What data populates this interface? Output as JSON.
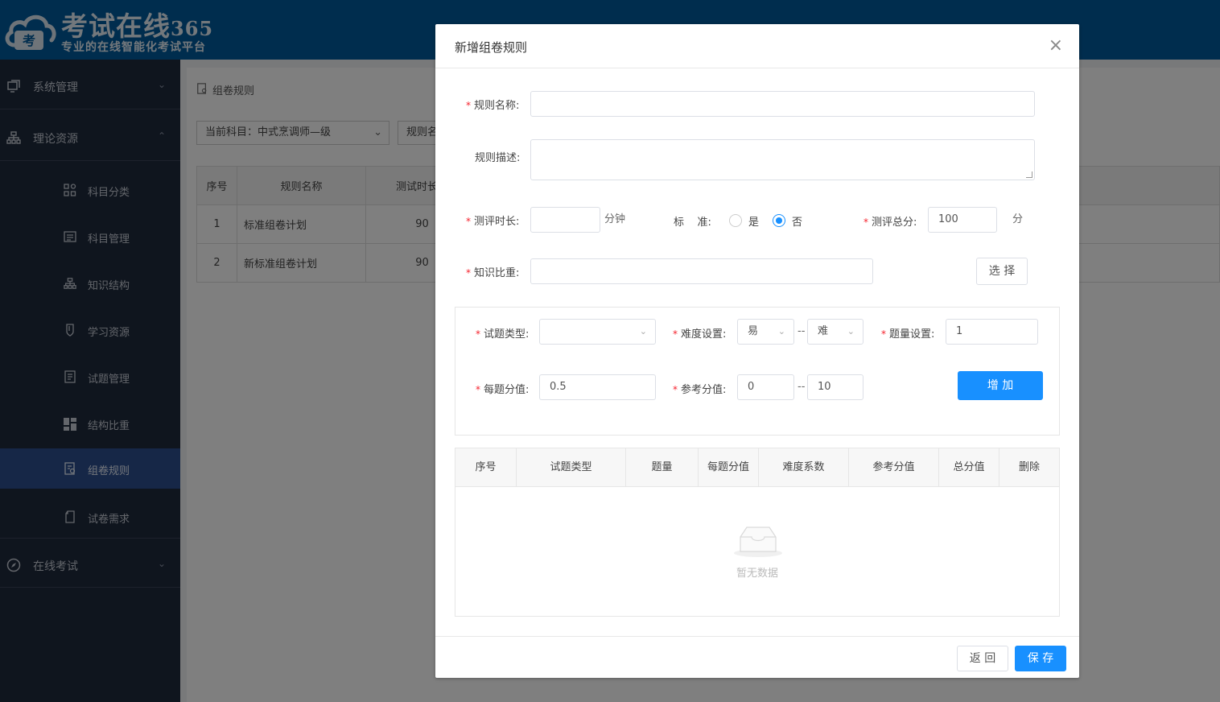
{
  "header": {
    "logo_badge": "考",
    "brand_title": "考试在线",
    "brand_num": "365",
    "brand_subtitle": "专业的在线智能化考试平台",
    "colors": {
      "header_bg": "#005a9c",
      "sidebar_bg": "#1f2a3d",
      "active_item": "#2c4f8f",
      "primary": "#1890ff",
      "required": "#f5222d"
    }
  },
  "sidebar": {
    "groups": [
      {
        "label": "系统管理",
        "icon": "monitor-icon",
        "arrow": "⌄"
      },
      {
        "label": "理论资源",
        "icon": "sitemap-icon",
        "arrow": "⌃"
      },
      {
        "label": "在线考试",
        "icon": "compass-icon",
        "arrow": "⌄"
      }
    ],
    "items": [
      {
        "label": "科目分类",
        "icon": "grid-icon"
      },
      {
        "label": "科目管理",
        "icon": "list-icon"
      },
      {
        "label": "知识结构",
        "icon": "sitemap-icon"
      },
      {
        "label": "学习资源",
        "icon": "bookmark-icon"
      },
      {
        "label": "试题管理",
        "icon": "document-icon"
      },
      {
        "label": "结构比重",
        "icon": "dashboard-icon"
      },
      {
        "label": "组卷规则",
        "icon": "rule-icon",
        "active": true
      },
      {
        "label": "试卷需求",
        "icon": "file-icon"
      }
    ]
  },
  "main": {
    "breadcrumb": "组卷规则",
    "subject_select": "当前科目：中式烹调师—级",
    "rule_filter_placeholder": "规则名",
    "table": {
      "headers": [
        "序号",
        "规则名称",
        "测试时长（"
      ],
      "rows": [
        [
          "1",
          "标准组卷计划",
          "90"
        ],
        [
          "2",
          "新标准组卷计划",
          "90"
        ]
      ]
    }
  },
  "dialog": {
    "title": "新增组卷规则",
    "close": "×",
    "rule_name_label": "规则名称:",
    "rule_name_value": "",
    "rule_desc_label": "规则描述:",
    "duration_label": "测评时长:",
    "duration_value": "",
    "duration_unit": "分钟",
    "standard_label": "标    准:",
    "standard_yes": "是",
    "standard_no": "否",
    "standard_selected": "否",
    "total_score_label": "测评总分:",
    "total_score_value": "100",
    "total_score_unit": "分",
    "knowledge_label": "知识比重:",
    "knowledge_value": "",
    "select_button": "选 择",
    "question_type_label": "试题类型:",
    "question_type_value": "",
    "difficulty_label": "难度设置:",
    "difficulty_from": "易",
    "difficulty_to": "难",
    "range_sep": "--",
    "quantity_label": "题量设置:",
    "quantity_value": "1",
    "per_score_label": "每题分值:",
    "per_score_value": "0.5",
    "ref_score_label": "参考分值:",
    "ref_score_from": "0",
    "ref_score_to": "10",
    "add_button": "增 加",
    "table_headers": [
      "序号",
      "试题类型",
      "题量",
      "每题分值",
      "难度系数",
      "参考分值",
      "总分值",
      "删除"
    ],
    "empty_text": "暂无数据",
    "back_button": "返 回",
    "save_button": "保 存"
  }
}
